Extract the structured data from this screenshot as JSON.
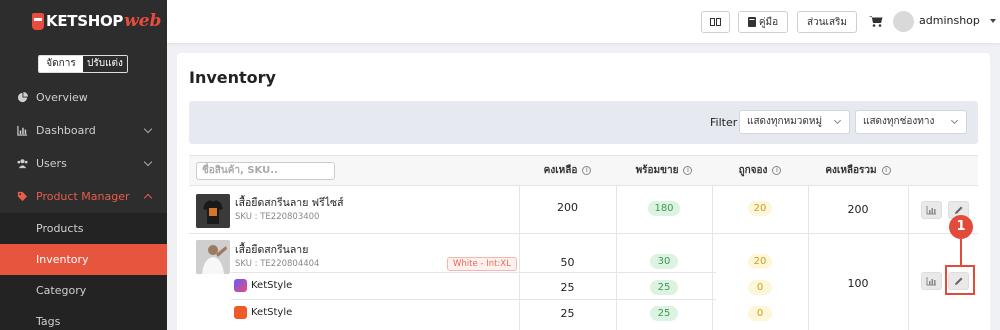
{
  "app": {
    "logo_text": "KETSHOP",
    "logo_suffix": "web"
  },
  "mode": {
    "active": "จัดการ",
    "inactive": "ปรับแต่ง"
  },
  "sidebar": {
    "items": [
      {
        "label": "Overview",
        "icon": "pie-chart-icon"
      },
      {
        "label": "Dashboard",
        "icon": "bar-chart-icon"
      },
      {
        "label": "Users",
        "icon": "users-icon"
      },
      {
        "label": "Product Manager",
        "icon": "tag-icon"
      }
    ],
    "subitems": [
      {
        "label": "Products"
      },
      {
        "label": "Inventory"
      },
      {
        "label": "Category"
      },
      {
        "label": "Tags"
      }
    ]
  },
  "topbar": {
    "grid_btn": "▭",
    "manual_btn": "คู่มือ",
    "addon_btn": "ส่วนเสริม",
    "username": "adminshop"
  },
  "page": {
    "title": "Inventory"
  },
  "filter": {
    "label": "Filter",
    "category_select": "แสดงทุกหมวดหมู่",
    "channel_select": "แสดงทุกช่องทาง"
  },
  "table": {
    "search_placeholder": "ชื่อสินค้า, SKU..",
    "headers": {
      "stock": "คงเหลือ",
      "ready": "พร้อมขาย",
      "reserved": "ถูกจอง",
      "total": "คงเหลือรวม"
    },
    "info_glyph": "i",
    "rows": [
      {
        "name": "เสื้อยืดสกรีนลาย ฟรีไซส์",
        "sku": "SKU : TE220803400",
        "stock": "200",
        "ready": "180",
        "reserved": "20",
        "total": "200"
      },
      {
        "name": "เสื้อยืดสกรีนลาย",
        "sku": "SKU : TE220804404",
        "variant": "White - Int:XL",
        "stock": "50",
        "ready": "30",
        "reserved": "20",
        "total": "100",
        "channels": [
          {
            "name": "KetStyle",
            "stock": "25",
            "ready": "25",
            "reserved": "0"
          },
          {
            "name": "KetStyle",
            "stock": "25",
            "ready": "25",
            "reserved": "0"
          }
        ]
      }
    ]
  },
  "callout": {
    "number": "1"
  },
  "colors": {
    "accent": "#e8553f",
    "sidebar_bg": "#2d2d2d"
  }
}
